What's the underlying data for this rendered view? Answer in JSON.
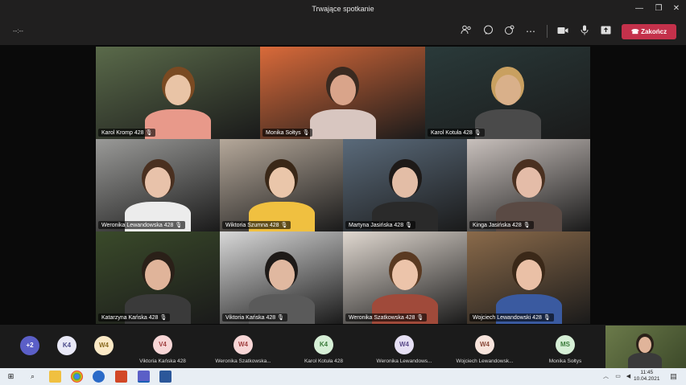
{
  "window": {
    "title": "Trwające spotkanie",
    "minimize": "—",
    "maximize": "❐",
    "close": "✕"
  },
  "toolbar": {
    "timer": "--:--",
    "end_label": "Zakończ",
    "end_icon": "☎"
  },
  "tiles": [
    {
      "name": "Karol Kromp 428",
      "bg": "#5a6a4a",
      "shirt": "#e8998a",
      "skin": "#e9c4a6",
      "hair": "#7a4a22"
    },
    {
      "name": "Monika Sołtys",
      "bg": "#d96a3a",
      "shirt": "#d8c6c0",
      "skin": "#d9a48a",
      "hair": "#3a2a20"
    },
    {
      "name": "Karol Kotuła 428",
      "bg": "#2a3a3a",
      "shirt": "#4a4a4a",
      "skin": "#d9b08a",
      "hair": "#c9a060"
    },
    {
      "name": "Weronika Lewandowska 428",
      "bg": "#9a9a98",
      "shirt": "#ececec",
      "skin": "#e8c2aa",
      "hair": "#4a3020"
    },
    {
      "name": "Wiktoria Szumna 428",
      "bg": "#b5a89a",
      "shirt": "#f0c040",
      "skin": "#eac6aa",
      "hair": "#3a2818"
    },
    {
      "name": "Martyna Jasińska 428",
      "bg": "#5a6a7a",
      "shirt": "#2a2a2a",
      "skin": "#e3bda6",
      "hair": "#1e1a18"
    },
    {
      "name": "Kinga Jasińska 428",
      "bg": "#c8c0bc",
      "shirt": "#5a4a44",
      "skin": "#e4bca8",
      "hair": "#4a3020"
    },
    {
      "name": "Katarzyna Kańska 428",
      "bg": "#3a4a2a",
      "shirt": "#3a3a3a",
      "skin": "#e0b49a",
      "hair": "#2a2018"
    },
    {
      "name": "Viktoria Kańska 428",
      "bg": "#d8d8d8",
      "shirt": "#5a5a5a",
      "skin": "#e0b8a0",
      "hair": "#1e1a18"
    },
    {
      "name": "Weronika Szatkowska 428",
      "bg": "#e0d8d0",
      "shirt": "#a04a3a",
      "skin": "#ecc4aa",
      "hair": "#5a3a22"
    },
    {
      "name": "Wojciech Lewandowski 428",
      "bg": "#8a6a4a",
      "shirt": "#3a5aa0",
      "skin": "#eac0a6",
      "hair": "#3a2818"
    }
  ],
  "roster": {
    "overflow": "+2",
    "left_avatars": [
      {
        "initials": "K4",
        "color": "#e9e9f7",
        "text": "#4a4a8a"
      },
      {
        "initials": "W4",
        "color": "#fbe9c6",
        "text": "#8a6a20"
      }
    ],
    "people": [
      {
        "initials": "V4",
        "name": "Viktoria Kańska 428",
        "color": "#f7d6d6",
        "text": "#a04040"
      },
      {
        "initials": "W4",
        "name": "Weronika Szatkowska...",
        "color": "#f7d6d6",
        "text": "#a04040"
      },
      {
        "initials": "K4",
        "name": "Karol Kotuła 428",
        "color": "#d6efd6",
        "text": "#3a7a3a"
      },
      {
        "initials": "W4",
        "name": "Weronika Lewandows...",
        "color": "#e6e0f4",
        "text": "#5a4a8a"
      },
      {
        "initials": "W4",
        "name": "Wojciech Lewandowsk...",
        "color": "#f7e4dc",
        "text": "#8a4a3a"
      },
      {
        "initials": "MS",
        "name": "Monika Sołtys",
        "color": "#d6efd6",
        "text": "#3a7a3a"
      }
    ]
  },
  "taskbar": {
    "time": "11:45",
    "date": "10.04.2021",
    "start_icon": "⊞",
    "search_icon": "⌕"
  }
}
